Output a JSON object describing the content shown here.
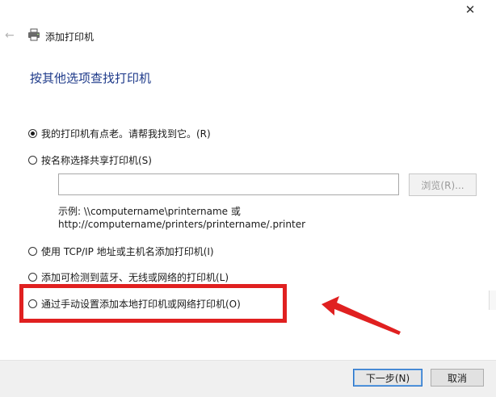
{
  "window": {
    "title": "添加打印机",
    "close_glyph": "✕",
    "back_glyph": "←"
  },
  "heading": "按其他选项查找打印机",
  "options": [
    {
      "label": "我的打印机有点老。请帮我找到它。(R)",
      "selected": true
    },
    {
      "label": "按名称选择共享打印机(S)",
      "selected": false
    },
    {
      "label": "使用 TCP/IP 地址或主机名添加打印机(I)",
      "selected": false
    },
    {
      "label": "添加可检测到蓝牙、无线或网络的打印机(L)",
      "selected": false
    },
    {
      "label": "通过手动设置添加本地打印机或网络打印机(O)",
      "selected": false
    }
  ],
  "share_name": {
    "value": "",
    "browse_label": "浏览(R)...",
    "hint_line1": "示例: \\\\computername\\printername 或",
    "hint_line2": "http://computername/printers/printername/.printer"
  },
  "buttons": {
    "next": "下一步(N)",
    "cancel": "取消"
  },
  "colors": {
    "heading": "#1e3a8a",
    "annotation": "#e02020",
    "focus_border": "#2a72c6"
  }
}
